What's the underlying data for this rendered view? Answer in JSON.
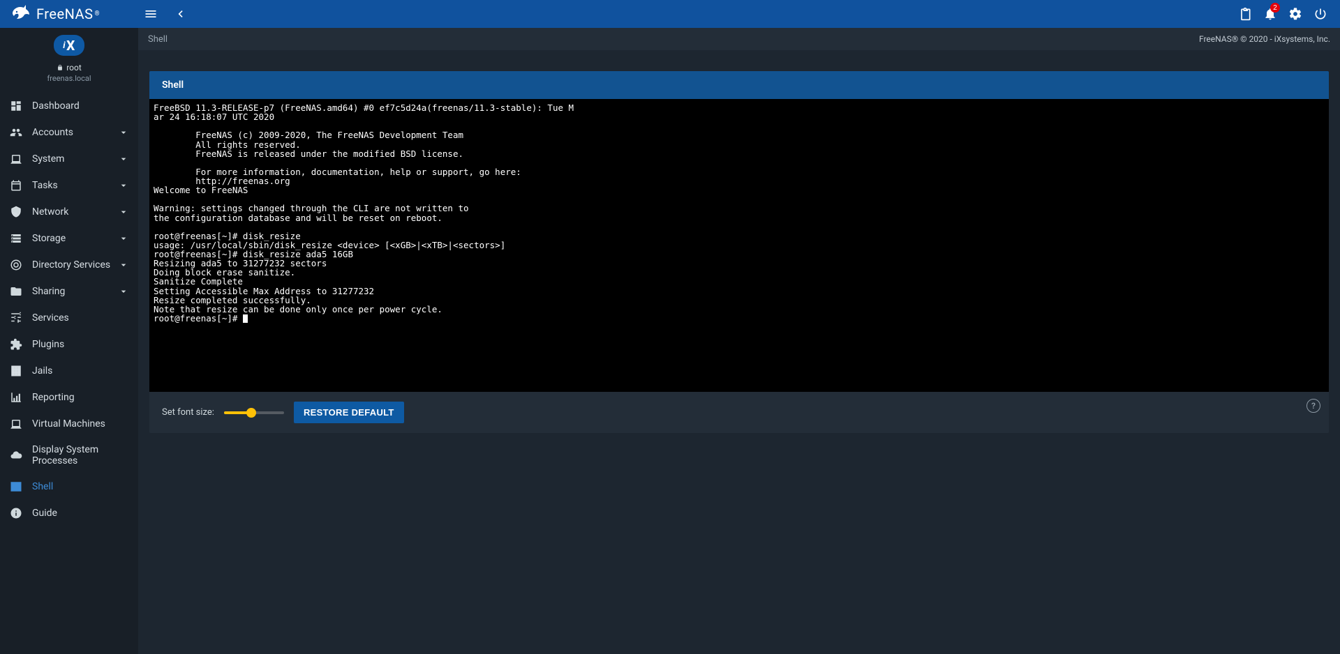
{
  "brand": "FreeNAS",
  "topbar": {
    "notification_count": "2"
  },
  "sidebar": {
    "user": "root",
    "host": "freenas.local",
    "items": [
      {
        "label": "Dashboard",
        "icon": "dashboard",
        "expandable": false,
        "active": false
      },
      {
        "label": "Accounts",
        "icon": "people",
        "expandable": true,
        "active": false
      },
      {
        "label": "System",
        "icon": "laptop",
        "expandable": true,
        "active": false
      },
      {
        "label": "Tasks",
        "icon": "calendar",
        "expandable": true,
        "active": false
      },
      {
        "label": "Network",
        "icon": "network",
        "expandable": true,
        "active": false
      },
      {
        "label": "Storage",
        "icon": "storage",
        "expandable": true,
        "active": false
      },
      {
        "label": "Directory Services",
        "icon": "target",
        "expandable": true,
        "active": false
      },
      {
        "label": "Sharing",
        "icon": "folder",
        "expandable": true,
        "active": false
      },
      {
        "label": "Services",
        "icon": "tune",
        "expandable": false,
        "active": false
      },
      {
        "label": "Plugins",
        "icon": "extension",
        "expandable": false,
        "active": false
      },
      {
        "label": "Jails",
        "icon": "jail",
        "expandable": false,
        "active": false
      },
      {
        "label": "Reporting",
        "icon": "chart",
        "expandable": false,
        "active": false
      },
      {
        "label": "Virtual Machines",
        "icon": "laptop",
        "expandable": false,
        "active": false
      },
      {
        "label": "Display System Processes",
        "icon": "cloud",
        "expandable": false,
        "active": false
      },
      {
        "label": "Shell",
        "icon": "terminal",
        "expandable": false,
        "active": true
      },
      {
        "label": "Guide",
        "icon": "info",
        "expandable": false,
        "active": false
      }
    ]
  },
  "breadcrumb": {
    "title": "Shell",
    "right": "FreeNAS® © 2020 - iXsystems, Inc."
  },
  "shell": {
    "panel_title": "Shell",
    "terminal_text": "FreeBSD 11.3-RELEASE-p7 (FreeNAS.amd64) #0 ef7c5d24a(freenas/11.3-stable): Tue M\nar 24 16:18:07 UTC 2020\n\n        FreeNAS (c) 2009-2020, The FreeNAS Development Team\n        All rights reserved.\n        FreeNAS is released under the modified BSD license.\n\n        For more information, documentation, help or support, go here:\n        http://freenas.org\nWelcome to FreeNAS\n\nWarning: settings changed through the CLI are not written to\nthe configuration database and will be reset on reboot.\n\nroot@freenas[~]# disk_resize\nusage: /usr/local/sbin/disk_resize <device> [<xGB>|<xTB>|<sectors>]\nroot@freenas[~]# disk_resize ada5 16GB\nResizing ada5 to 31277232 sectors\nDoing block erase sanitize.\nSanitize Complete\nSetting Accessible Max Address to 31277232\nResize completed successfully.\nNote that resize can be done only once per power cycle.\nroot@freenas[~]# ",
    "footer": {
      "font_size_label": "Set font size:",
      "restore_default": "RESTORE DEFAULT",
      "help_char": "?"
    }
  }
}
